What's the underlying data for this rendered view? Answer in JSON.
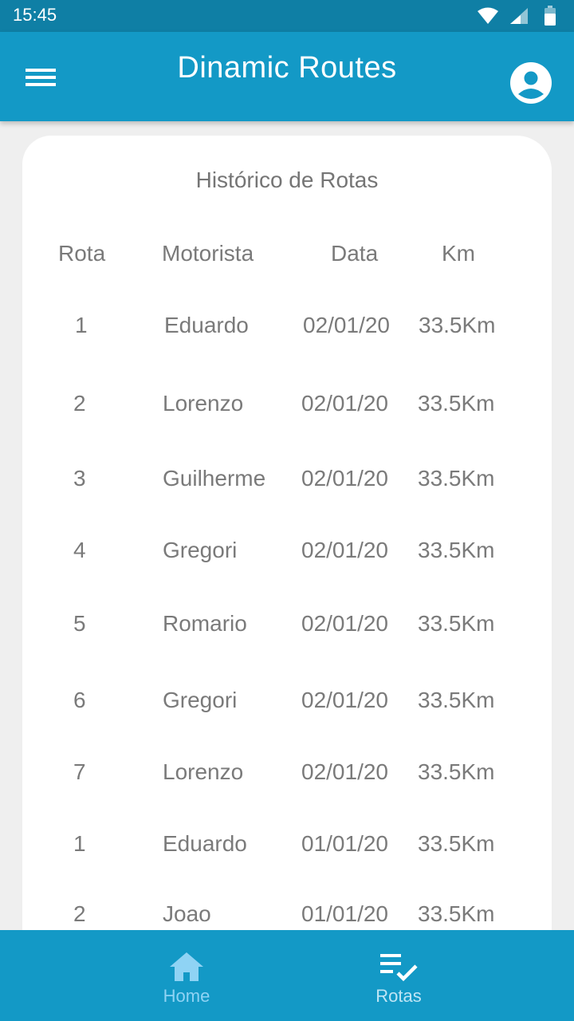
{
  "status_bar": {
    "time": "15:45"
  },
  "app_bar": {
    "title": "Dinamic Routes"
  },
  "card": {
    "title": "Histórico de Rotas",
    "columns": [
      "Rota",
      "Motorista",
      "Data",
      "Km"
    ],
    "rows": [
      [
        "1",
        "Eduardo",
        "02/01/20",
        "33.5Km"
      ],
      [
        "2",
        "Lorenzo",
        "02/01/20",
        "33.5Km"
      ],
      [
        "3",
        "Guilherme",
        "02/01/20",
        "33.5Km"
      ],
      [
        "4",
        "Gregori",
        "02/01/20",
        "33.5Km"
      ],
      [
        "5",
        "Romario",
        "02/01/20",
        "33.5Km"
      ],
      [
        "6",
        "Gregori",
        "02/01/20",
        "33.5Km"
      ],
      [
        "7",
        "Lorenzo",
        "02/01/20",
        "33.5Km"
      ],
      [
        "1",
        "Eduardo",
        "01/01/20",
        "33.5Km"
      ],
      [
        "2",
        "Joao",
        "01/01/20",
        "33.5Km"
      ]
    ]
  },
  "bottom_nav": {
    "items": [
      {
        "label": "Home",
        "icon": "home-icon"
      },
      {
        "label": "Rotas",
        "icon": "checklist-icon"
      }
    ]
  },
  "colors": {
    "status_bar": "#0f7fa5",
    "app_bar": "#1399c6",
    "background": "#efefef",
    "text": "#7a7a7a",
    "home_active": "#8fd3f4"
  }
}
